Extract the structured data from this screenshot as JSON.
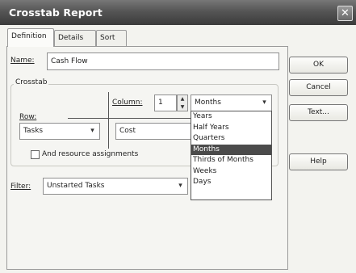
{
  "window": {
    "title": "Crosstab Report",
    "close_glyph": "✕"
  },
  "tabs": [
    {
      "label": "Definition"
    },
    {
      "label": "Details"
    },
    {
      "label": "Sort"
    }
  ],
  "name_field": {
    "label": "Name:",
    "value": "Cash Flow"
  },
  "crosstab_group": {
    "title": "Crosstab",
    "column_label": "Column:",
    "column_count": "1",
    "column_unit": "Months",
    "row_label": "Row:",
    "row_value": "Tasks",
    "cost_value": "Cost",
    "checkbox_label": "And resource assignments"
  },
  "unit_options": [
    "Years",
    "Half Years",
    "Quarters",
    "Months",
    "Thirds of Months",
    "Weeks",
    "Days"
  ],
  "selected_unit_index": 3,
  "filter": {
    "label": "Filter:",
    "value": "Unstarted Tasks"
  },
  "buttons": {
    "ok": "OK",
    "cancel": "Cancel",
    "text": "Text...",
    "help": "Help"
  },
  "icons": {
    "dropdown": "chevron-down-icon",
    "spin_up": "triangle-up-icon",
    "spin_down": "triangle-down-icon"
  }
}
